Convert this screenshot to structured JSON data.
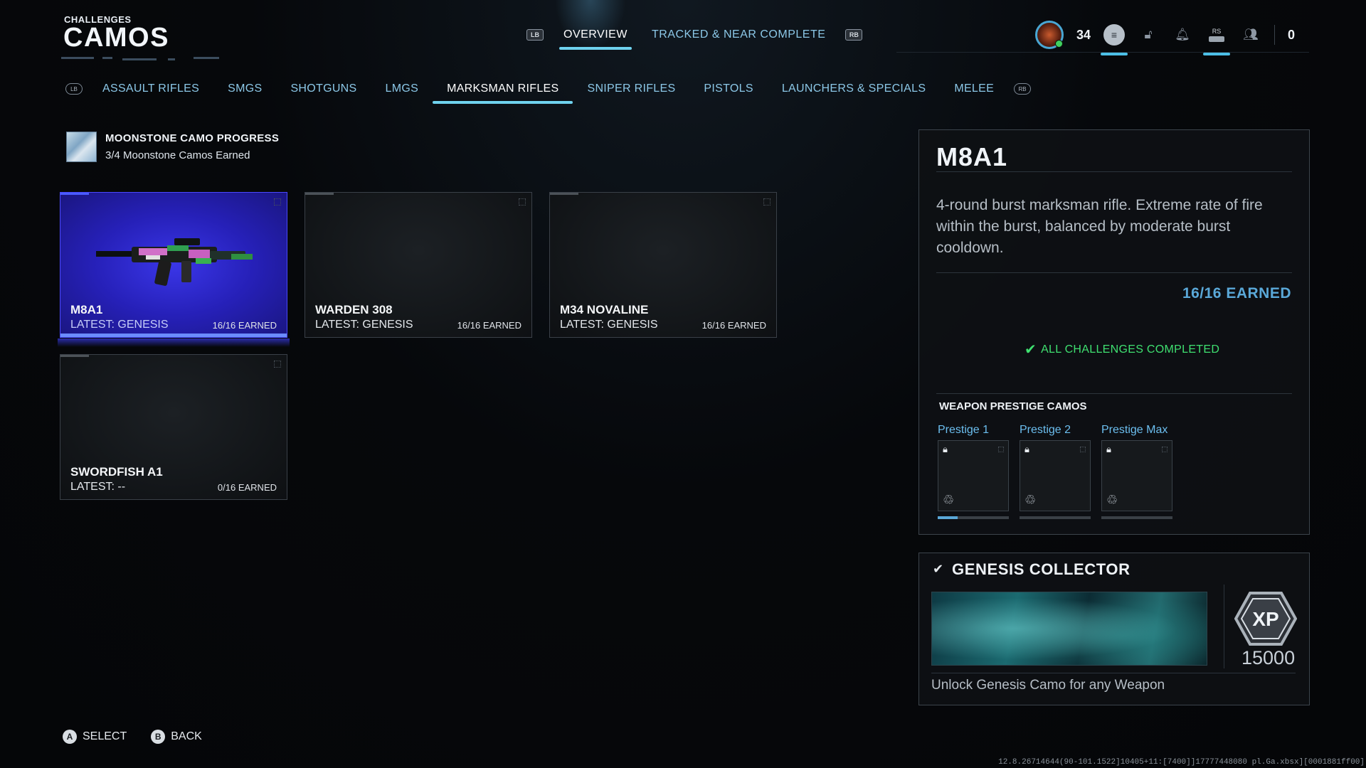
{
  "header": {
    "section": "CHALLENGES",
    "title": "CAMOS"
  },
  "topnav": {
    "lb": "LB",
    "rb": "RB",
    "tabs": [
      {
        "label": "OVERVIEW"
      },
      {
        "label": "TRACKED & NEAR COMPLETE"
      }
    ]
  },
  "hud": {
    "level": "34",
    "rs": "RS",
    "count": "0"
  },
  "categories": {
    "lb": "LB",
    "rb": "RB",
    "items": [
      {
        "label": "ASSAULT RIFLES"
      },
      {
        "label": "SMGS"
      },
      {
        "label": "SHOTGUNS"
      },
      {
        "label": "LMGS"
      },
      {
        "label": "MARKSMAN RIFLES"
      },
      {
        "label": "SNIPER RIFLES"
      },
      {
        "label": "PISTOLS"
      },
      {
        "label": "LAUNCHERS & SPECIALS"
      },
      {
        "label": "MELEE"
      }
    ]
  },
  "moonstone": {
    "title": "MOONSTONE CAMO PROGRESS",
    "subtitle": "3/4 Moonstone Camos Earned"
  },
  "weapons": [
    {
      "name": "M8A1",
      "latest": "LATEST: GENESIS",
      "earned": "16/16 EARNED"
    },
    {
      "name": "WARDEN 308",
      "latest": "LATEST: GENESIS",
      "earned": "16/16 EARNED"
    },
    {
      "name": "M34 NOVALINE",
      "latest": "LATEST: GENESIS",
      "earned": "16/16 EARNED"
    },
    {
      "name": "SWORDFISH A1",
      "latest": "LATEST: --",
      "earned": "0/16 EARNED"
    }
  ],
  "detail": {
    "title": "M8A1",
    "description": "4-round burst marksman rifle. Extreme rate of fire within the burst, balanced by moderate burst cooldown.",
    "earned": "16/16 EARNED",
    "status": "ALL CHALLENGES COMPLETED",
    "prestige_header": "WEAPON PRESTIGE CAMOS",
    "prestige": [
      {
        "label": "Prestige 1"
      },
      {
        "label": "Prestige 2"
      },
      {
        "label": "Prestige Max"
      }
    ]
  },
  "collector": {
    "title": "GENESIS COLLECTOR",
    "xp_badge": "XP",
    "xp": "15000",
    "description": "Unlock Genesis Camo for any Weapon"
  },
  "footer": {
    "select_key": "A",
    "select_label": "SELECT",
    "back_key": "B",
    "back_label": "BACK",
    "build": "12.8.26714644(90-101.1522]10405+11:[7400]]17777448080 pl.Ga.xbsx][0001881ff00]"
  },
  "colors": {
    "accent": "#6fd2ee",
    "selected_card": "#2a26c8",
    "complete": "#3fe070",
    "earned": "#5aa8d8"
  }
}
